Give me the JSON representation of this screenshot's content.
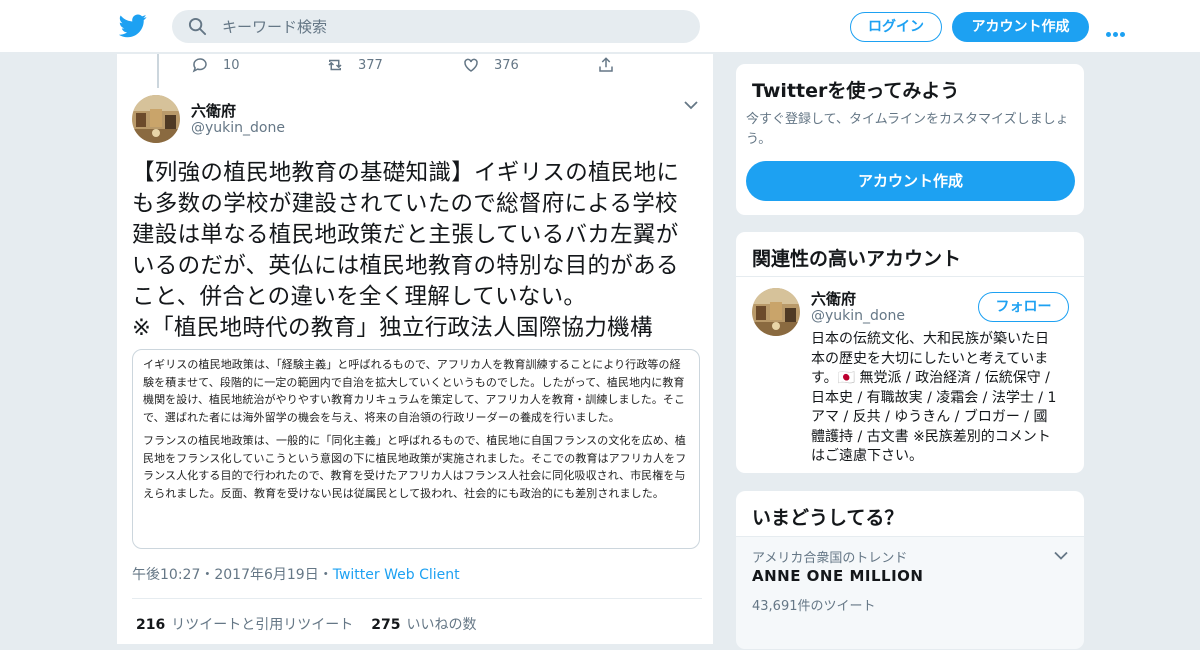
{
  "header": {
    "search_placeholder": "キーワード検索",
    "login_label": "ログイン",
    "signup_label": "アカウント作成"
  },
  "prev_tweet_actions": {
    "reply_count": "10",
    "retweet_count": "377",
    "like_count": "376"
  },
  "tweet": {
    "author_name": "六衛府",
    "author_handle": "@yukin_done",
    "text_lines": [
      "【列強の植民地教育の基礎知識】イギリスの植民地に",
      "も多数の学校が建設されていたので総督府による学校",
      "建設は単なる植民地政策だと主張しているバカ左翼が",
      "いるのだが、英仏には植民地教育の特別な目的がある",
      "こと、併合との違いを全く理解していない。",
      "※「植民地時代の教育」独立行政法人国際協力機構"
    ],
    "image_paragraphs": [
      "イギリスの植民地政策は、「経験主義」と呼ばれるもので、アフリカ人を教育訓練することにより行政等の経験を積ませて、段階的に一定の範囲内で自治を拡大していくというものでした。したがって、植民地内に教育機関を設け、植民地統治がやりやすい教育カリキュラムを策定して、アフリカ人を教育・訓練しました。そこで、選ばれた者には海外留学の機会を与え、将来の自治領の行政リーダーの養成を行いました。",
      "フランスの植民地政策は、一般的に「同化主義」と呼ばれるもので、植民地に自国フランスの文化を広め、植民地をフランス化していこうという意図の下に植民地政策が実施されました。そこでの教育はアフリカ人をフランス人化する目的で行われたので、教育を受けたアフリカ人はフランス人社会に同化吸収され、市民権を与えられました。反面、教育を受けない民は従属民として扱われ、社会的にも政治的にも差別されました。"
    ],
    "time": "午後10:27",
    "date": "2017年6月19日",
    "client": "Twitter Web Client",
    "sep": "・",
    "retweet_count": "216",
    "retweet_label": "リツイートと引用リツイート",
    "like_count": "275",
    "like_label": "いいねの数"
  },
  "sidebar": {
    "try_twitter": {
      "title": "Twitterを使ってみよう",
      "description": "今すぐ登録して、タイムラインをカスタマイズしましょう。",
      "button": "アカウント作成"
    },
    "related": {
      "title": "関連性の高いアカウント",
      "name": "六衛府",
      "handle": "@yukin_done",
      "follow_label": "フォロー",
      "bio_lines": [
        "日本の伝統文化、大和民族が築いた日",
        "本の歴史を大切にしたいと考えていま",
        "す。🇯🇵 無党派 / 政治経済 / 伝統保守 /",
        "日本史 / 有職故実 / 凌霜会 / 法学士 / 1",
        "アマ / 反共 / ゆうきん / ブロガー / 國",
        "體護持 / 古文書 ※民族差別的コメント",
        "はご遠慮下さい。"
      ]
    },
    "trends": {
      "title": "いまどうしてる？",
      "context": "アメリカ合衆国のトレンド",
      "name": "ANNE ONE MILLION",
      "count": "43,691件のツイート"
    }
  },
  "colors": {
    "accent": "#1da1f2",
    "background": "#e6ecf0",
    "secondary_text": "#657786"
  }
}
